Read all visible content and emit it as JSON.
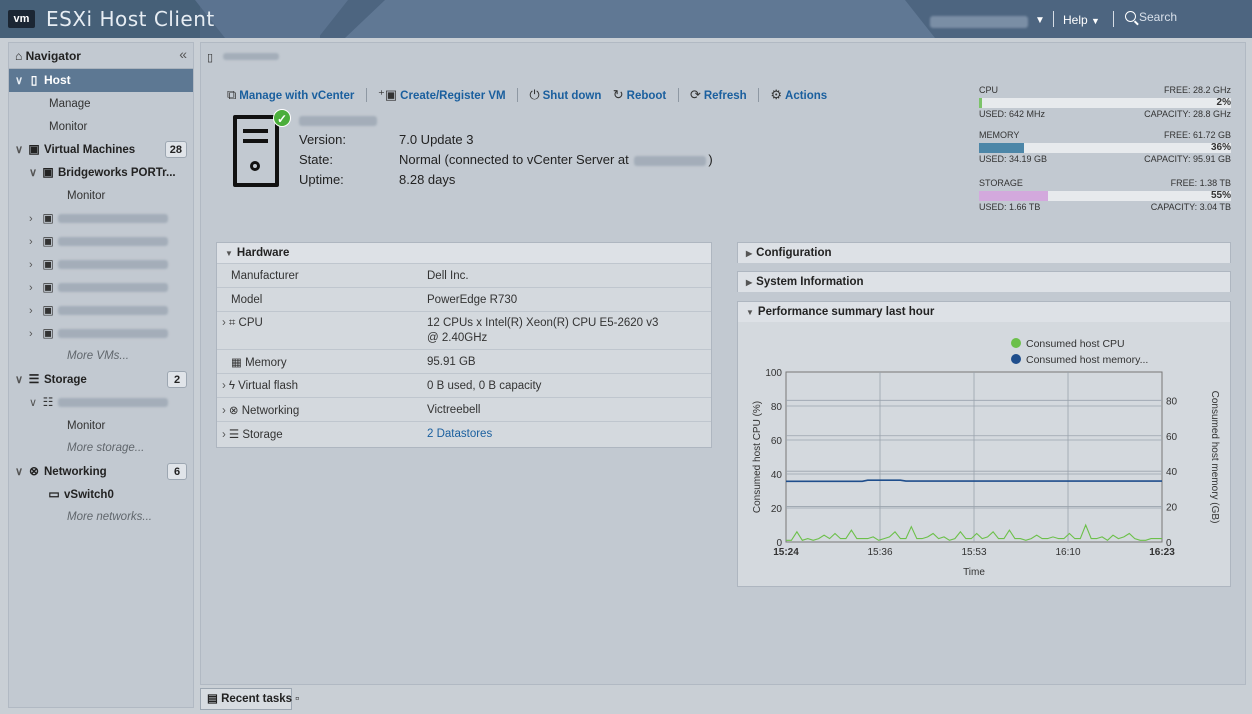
{
  "header": {
    "logo": "vm",
    "app_title": "ESXi Host Client",
    "help_label": "Help",
    "search_placeholder": "Search"
  },
  "navigator": {
    "title": "Navigator",
    "host_label": "Host",
    "manage_label": "Manage",
    "monitor_label": "Monitor",
    "vms_label": "Virtual Machines",
    "vms_count": "28",
    "vm_bridgeworks": "Bridgeworks PORTr...",
    "vm_monitor_label": "Monitor",
    "more_vms": "More VMs...",
    "storage_label": "Storage",
    "storage_count": "2",
    "storage_monitor": "Monitor",
    "more_storage": "More storage...",
    "networking_label": "Networking",
    "networking_count": "6",
    "vswitch": "vSwitch0",
    "more_networks": "More networks..."
  },
  "toolbar": {
    "manage_vcenter": "Manage with vCenter",
    "create_vm": "Create/Register VM",
    "shutdown": "Shut down",
    "reboot": "Reboot",
    "refresh": "Refresh",
    "actions": "Actions"
  },
  "host": {
    "version_label": "Version:",
    "version": "7.0 Update 3",
    "state_label": "State:",
    "state_prefix": "Normal (connected to vCenter Server at",
    "state_suffix": ")",
    "uptime_label": "Uptime:",
    "uptime": "8.28 days"
  },
  "resources": {
    "cpu": {
      "name": "CPU",
      "free": "FREE: 28.2 GHz",
      "percent": "2%",
      "fill": 0.02,
      "used": "USED: 642 MHz",
      "capacity": "CAPACITY: 28.8 GHz",
      "color": "#7cc36a"
    },
    "memory": {
      "name": "MEMORY",
      "free": "FREE: 61.72 GB",
      "percent": "36%",
      "fill": 0.36,
      "used": "USED: 34.19 GB",
      "capacity": "CAPACITY: 95.91 GB",
      "color": "#4c86a8"
    },
    "storage": {
      "name": "STORAGE",
      "free": "FREE: 1.38 TB",
      "percent": "55%",
      "fill": 0.55,
      "used": "USED: 1.66 TB",
      "capacity": "CAPACITY: 3.04 TB",
      "color": "#d3a9dd"
    }
  },
  "hardware": {
    "title": "Hardware",
    "rows": [
      {
        "key": "Manufacturer",
        "value": "Dell Inc."
      },
      {
        "key": "Model",
        "value": "PowerEdge R730"
      },
      {
        "key": "CPU",
        "value": "12 CPUs x Intel(R) Xeon(R) CPU E5-2620 v3 @ 2.40GHz"
      },
      {
        "key": "Memory",
        "value": "95.91 GB"
      },
      {
        "key": "Virtual flash",
        "value": "0 B used, 0 B capacity"
      },
      {
        "key": "Networking",
        "value": "Victreebell"
      },
      {
        "key": "Storage",
        "value": "2 Datastores"
      }
    ]
  },
  "panels": {
    "configuration": "Configuration",
    "system_information": "System Information",
    "performance": "Performance summary last hour"
  },
  "chart_data": {
    "type": "line",
    "title": "",
    "xlabel": "Time",
    "ylabel": "Consumed host CPU (%)",
    "y2label": "Consumed host memory (GB)",
    "x_ticks": [
      "15:24",
      "15:36",
      "15:53",
      "16:10",
      "16:23"
    ],
    "ylim": [
      0,
      100
    ],
    "y_ticks": [
      0,
      20,
      40,
      60,
      80,
      100
    ],
    "y2lim": [
      0,
      96
    ],
    "y2_ticks": [
      0,
      20,
      40,
      60,
      80
    ],
    "grid": true,
    "legend_placement": "top-right",
    "series": [
      {
        "name": "Consumed host CPU",
        "color": "#6cc04a",
        "axis": "left",
        "values": [
          1,
          1,
          6,
          1,
          2,
          1,
          2,
          4,
          2,
          5,
          2,
          2,
          7,
          2,
          2,
          2,
          3,
          1,
          2,
          3,
          6,
          2,
          2,
          9,
          2,
          2,
          3,
          5,
          2,
          3,
          1,
          2,
          6,
          2,
          2,
          5,
          2,
          3,
          6,
          2,
          2,
          7,
          2,
          2,
          1,
          2,
          4,
          2,
          2,
          3,
          2,
          2,
          5,
          2,
          2,
          10,
          2,
          2,
          3,
          1,
          4,
          2,
          3,
          5,
          2,
          1,
          1,
          2,
          2,
          2
        ]
      },
      {
        "name": "Consumed host memory...",
        "color": "#1f4e8c",
        "axis": "right",
        "values": [
          34.3,
          34.3,
          34.3,
          34.3,
          34.3,
          34.3,
          34.3,
          34.3,
          34.3,
          34.3,
          34.3,
          34.3,
          34.3,
          34.3,
          34.3,
          34.9,
          34.9,
          34.9,
          34.9,
          34.9,
          34.9,
          34.9,
          34.4,
          34.4,
          34.4,
          34.4,
          34.4,
          34.4,
          34.4,
          34.4,
          34.4,
          34.4,
          34.4,
          34.4,
          34.4,
          34.4,
          34.4,
          34.4,
          34.4,
          34.4,
          34.4,
          34.4,
          34.4,
          34.4,
          34.4,
          34.4,
          34.4,
          34.4,
          34.4,
          34.4,
          34.4,
          34.4,
          34.4,
          34.4,
          34.4,
          34.4,
          34.4,
          34.4,
          34.4,
          34.4,
          34.4,
          34.4,
          34.4,
          34.4,
          34.4,
          34.4,
          34.4,
          34.4,
          34.4,
          34.4
        ]
      }
    ]
  },
  "footer": {
    "recent_tasks": "Recent tasks"
  }
}
